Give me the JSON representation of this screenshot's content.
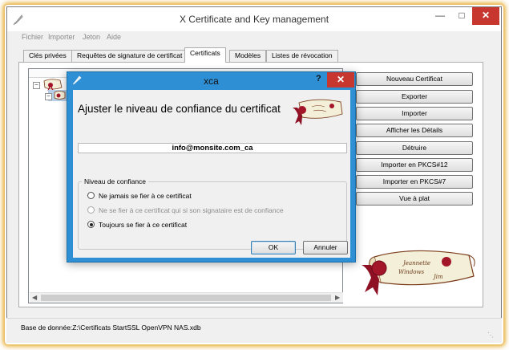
{
  "window": {
    "title": "X Certificate and Key management"
  },
  "menu": [
    "Fichier",
    "Importer",
    "Jeton",
    "Aide"
  ],
  "tabs": [
    "Clés privées",
    "Requêtes de signature de certificat",
    "Certificats",
    "Modèles",
    "Listes de révocation"
  ],
  "active_tab": "Certificats",
  "actions": [
    "Nouveau Certificat",
    "Exporter",
    "Importer",
    "Afficher les Détails",
    "Détruire",
    "Importer en PKCS#12",
    "Importer en PKCS#7",
    "Vue à plat"
  ],
  "status": {
    "text": "Base de donnée:Z:\\Certificats StartSSL OpenVPN NAS.xdb"
  },
  "dialog": {
    "title": "xca",
    "help": "?",
    "heading": "Ajuster le niveau de confiance du certificat",
    "subject": "info@monsite.com_ca",
    "group_label": "Niveau de confiance",
    "options": [
      {
        "label": "Ne jamais se fier à ce certificat",
        "checked": false,
        "enabled": true
      },
      {
        "label": "Ne se fier à ce certificat qui si son signataire est de confiance",
        "checked": false,
        "enabled": false
      },
      {
        "label": "Toujours se fier à ce certificat",
        "checked": true,
        "enabled": true
      }
    ],
    "ok_label": "OK",
    "cancel_label": "Annuler"
  },
  "logo": {
    "script_text": "Jeannette Windows Jim"
  }
}
